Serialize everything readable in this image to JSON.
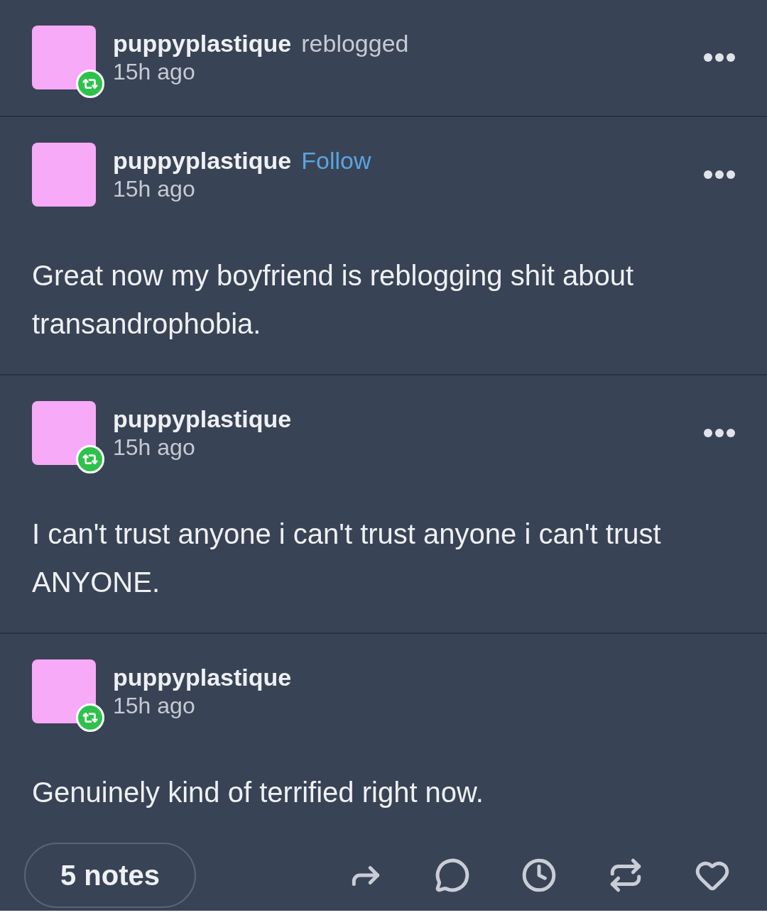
{
  "header": {
    "username": "puppyplastique",
    "action": "reblogged",
    "time": "15h ago",
    "reblog_badge": true,
    "menu": true
  },
  "posts": [
    {
      "username": "puppyplastique",
      "follow": "Follow",
      "time": "15h ago",
      "reblog_badge": false,
      "menu": true,
      "body": "Great now my boyfriend is reblogging shit about transandrophobia."
    },
    {
      "username": "puppyplastique",
      "time": "15h ago",
      "reblog_badge": true,
      "menu": true,
      "body": "I can't trust anyone i can't trust anyone i can't trust ANYONE."
    },
    {
      "username": "puppyplastique",
      "time": "15h ago",
      "reblog_badge": true,
      "menu": false,
      "body": "Genuinely kind of terrified right now."
    }
  ],
  "footer": {
    "notes": "5 notes",
    "actions": [
      {
        "kind": "share"
      },
      {
        "kind": "reply"
      },
      {
        "kind": "schedule"
      },
      {
        "kind": "reblog"
      },
      {
        "kind": "like"
      }
    ]
  }
}
